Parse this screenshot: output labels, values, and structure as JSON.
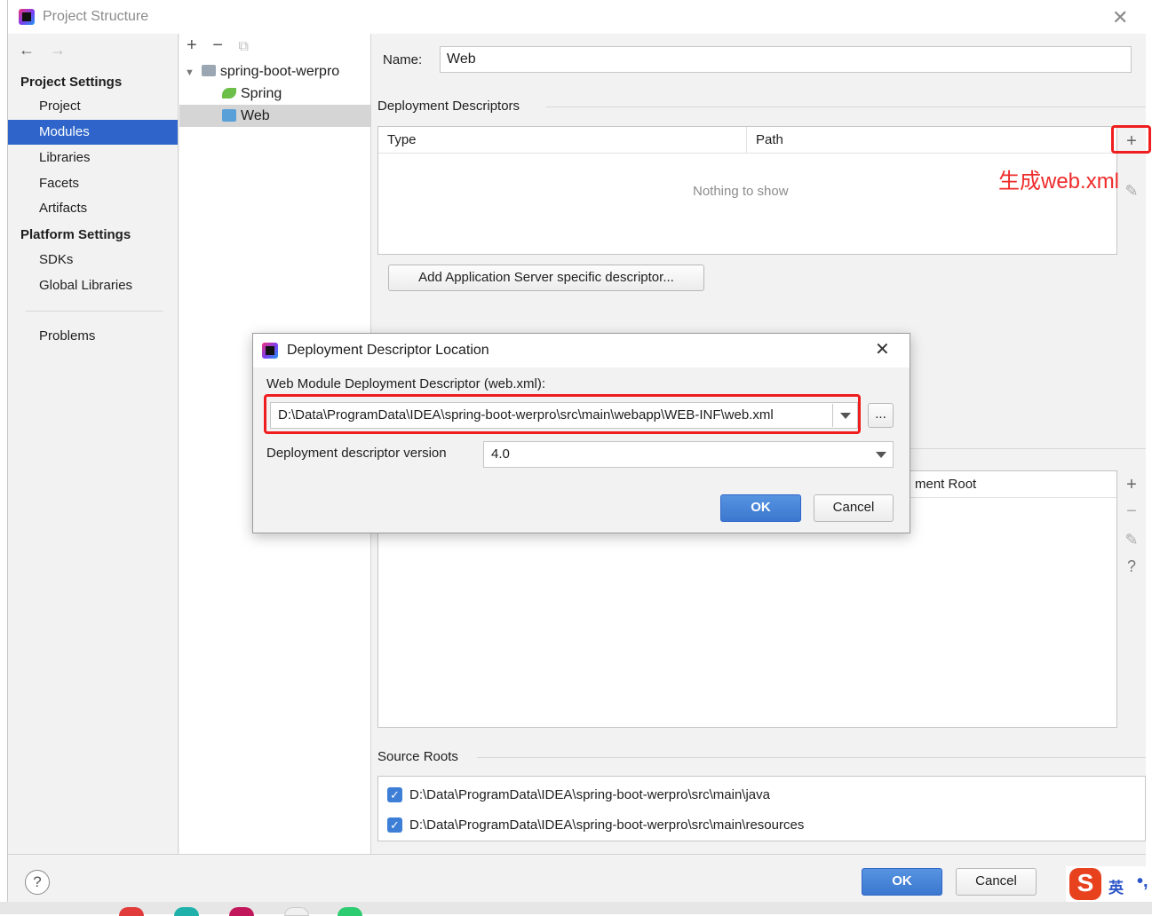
{
  "window": {
    "title": "Project Structure"
  },
  "left_nav": {
    "project_settings_heading": "Project Settings",
    "items_top": [
      "Project",
      "Modules",
      "Libraries",
      "Facets",
      "Artifacts"
    ],
    "platform_settings_heading": "Platform Settings",
    "items_platform": [
      "SDKs",
      "Global Libraries"
    ],
    "problems": "Problems",
    "selected": "Modules"
  },
  "tree": {
    "root": "spring-boot-werpro",
    "children": [
      "Spring",
      "Web"
    ],
    "selected": "Web"
  },
  "main": {
    "name_label": "Name:",
    "name_value": "Web",
    "deployment_descriptors_title": "Deployment Descriptors",
    "col_type": "Type",
    "col_path": "Path",
    "empty_text": "Nothing to show",
    "add_server_descriptor_button": "Add Application Server specific descriptor...",
    "partial_column_header": "ment Root",
    "source_roots_title": "Source Roots",
    "source_roots": [
      "D:\\Data\\ProgramData\\IDEA\\spring-boot-werpro\\src\\main\\java",
      "D:\\Data\\ProgramData\\IDEA\\spring-boot-werpro\\src\\main\\resources"
    ]
  },
  "annotation": {
    "note": "生成web.xml",
    "color": "#ef2b2b"
  },
  "dialog": {
    "title": "Deployment Descriptor Location",
    "descriptor_label": "Web Module Deployment Descriptor (web.xml):",
    "descriptor_path": "D:\\Data\\ProgramData\\IDEA\\spring-boot-werpro\\src\\main\\webapp\\WEB-INF\\web.xml",
    "browse_button": "...",
    "version_label": "Deployment descriptor version",
    "version_value": "4.0",
    "ok": "OK",
    "cancel": "Cancel"
  },
  "footer": {
    "help": "?",
    "ok": "OK",
    "cancel": "Cancel"
  },
  "ime": {
    "logo": "S",
    "lang": "英",
    "punct": "•,"
  },
  "colors": {
    "selection": "#2f65ca",
    "primary_button": "#3c78cf",
    "highlight_box": "#ef1d1d"
  },
  "icons": {
    "add": "+",
    "remove": "−",
    "copy": "⧉",
    "edit": "✎",
    "help": "?",
    "back": "←",
    "forward": "→",
    "close": "✕",
    "check": "✓"
  }
}
